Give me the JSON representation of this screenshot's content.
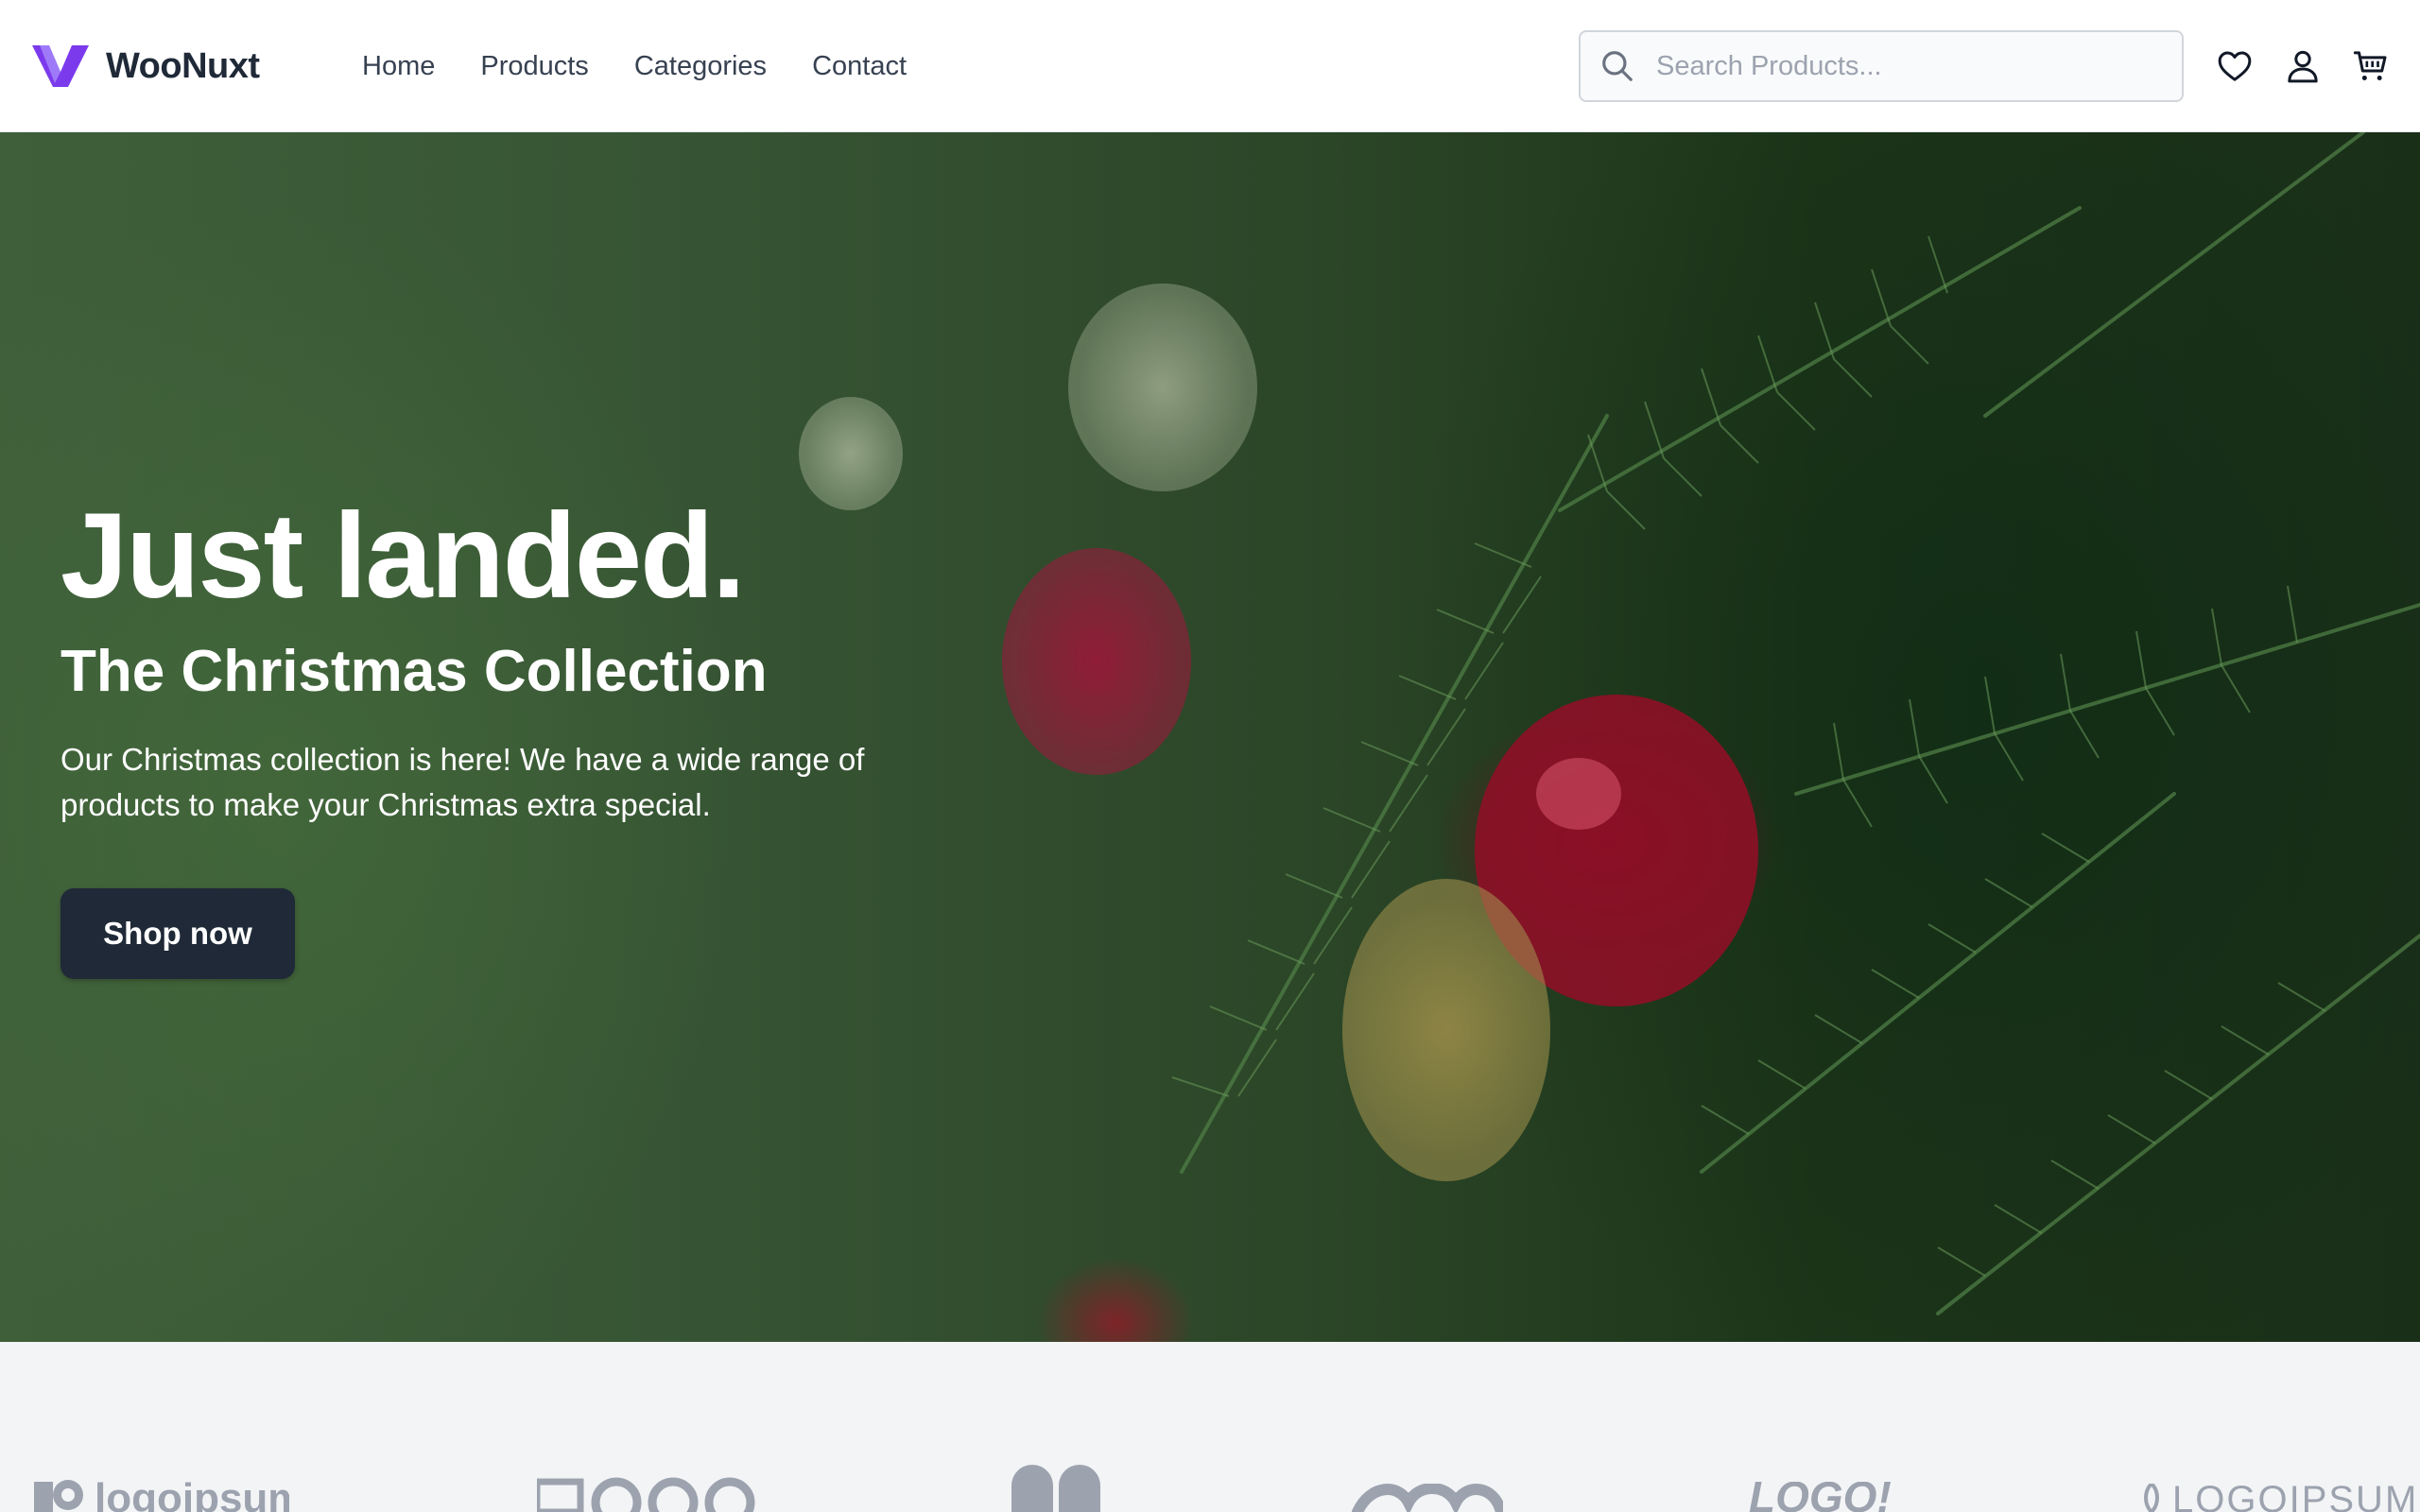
{
  "brand": {
    "name": "WooNuxt",
    "logo_color": "#7c3aed"
  },
  "nav": {
    "items": [
      "Home",
      "Products",
      "Categories",
      "Contact"
    ]
  },
  "search": {
    "placeholder": "Search Products..."
  },
  "header_icons": [
    "heart-icon",
    "user-icon",
    "cart-icon"
  ],
  "hero": {
    "title": "Just landed.",
    "subtitle": "The Christmas Collection",
    "description": "Our Christmas collection is here! We have a wide range of products to make your Christmas extra special.",
    "cta": "Shop now",
    "button_color": "#1f2937"
  },
  "logos": [
    "logoipsum",
    "LOGO",
    "logo-mark",
    "logo-infinity",
    "LOGO!",
    "LOGOIPSUM"
  ]
}
